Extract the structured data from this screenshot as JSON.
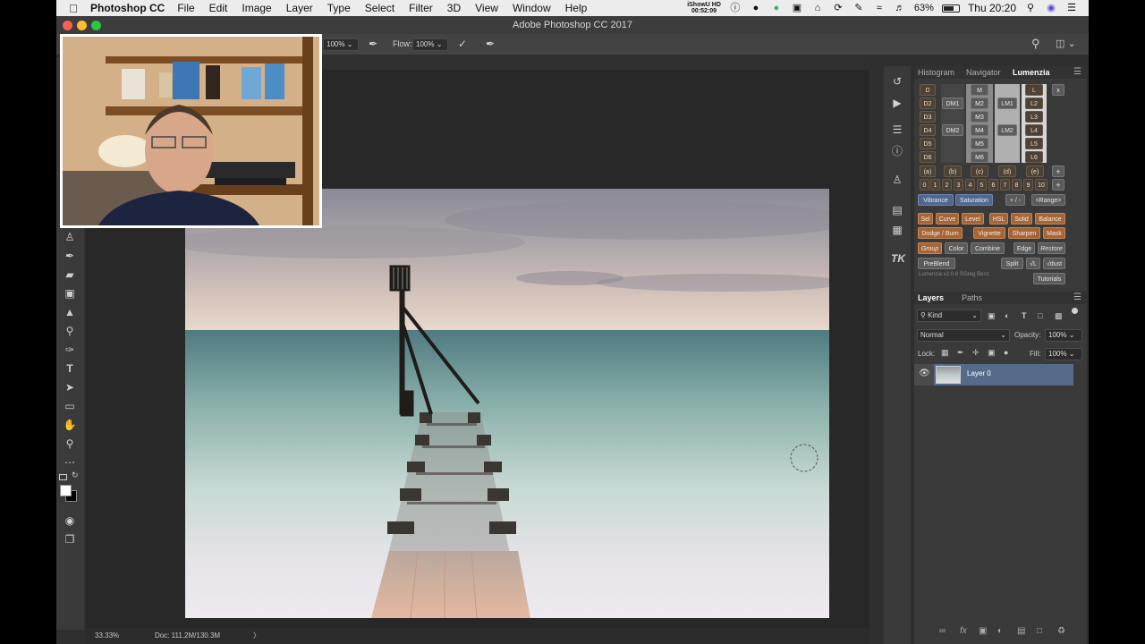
{
  "menubar": {
    "app_name": "Photoshop CC",
    "items": [
      "File",
      "Edit",
      "Image",
      "Layer",
      "Type",
      "Select",
      "Filter",
      "3D",
      "View",
      "Window",
      "Help"
    ],
    "ishowu_line1": "iShowU HD",
    "ishowu_line2": "00:52:09",
    "battery": "63%",
    "clock": "Thu 20:20"
  },
  "window": {
    "title": "Adobe Photoshop CC 2017"
  },
  "options": {
    "opacity_value": "100%",
    "flow_label": "Flow:",
    "flow_value": "100%"
  },
  "status": {
    "zoom": "33.33%",
    "doc": "Doc: 111.2M/130.3M",
    "arrow": "〉"
  },
  "panels": {
    "top_tabs": [
      "Histogram",
      "Navigator",
      "Lumenzia"
    ],
    "lumenzia": {
      "col_d": [
        "D",
        "D2",
        "D3",
        "D4",
        "D5",
        "D6"
      ],
      "col_dm": [
        "DM1",
        "DM2"
      ],
      "col_m": [
        "M",
        "M2",
        "M3",
        "M4",
        "M5",
        "M6"
      ],
      "col_lm": [
        "LM1",
        "LM2"
      ],
      "col_l": [
        "L",
        "L2",
        "L3",
        "L4",
        "L5",
        "L6"
      ],
      "close": "x",
      "paren_row": [
        "(a)",
        "(b)",
        "(c)",
        "(d)",
        "(e)"
      ],
      "plus": "+",
      "number_row": [
        "0",
        "1",
        "2",
        "3",
        "4",
        "5",
        "6",
        "7",
        "8",
        "9",
        "10"
      ],
      "vibrance": "Vibrance",
      "saturation": "Saturation",
      "plusminus": "+ / -",
      "range": "<Range>",
      "row_a": [
        "Sel",
        "Curve",
        "Level",
        "HSL",
        "Solid",
        "Balance"
      ],
      "row_b": [
        "Dodge / Burn",
        "Vignette",
        "Sharpen",
        "Mask"
      ],
      "row_c": [
        "Group",
        "Color",
        "Combine",
        "Edge",
        "Restore"
      ],
      "row_d": [
        "PreBlend",
        "Split",
        "√L",
        "√dust"
      ],
      "version": "Lumenzia v2.0.8 ©Greg Benz",
      "tutorials": "Tutorials"
    },
    "layers_tabs": [
      "Layers",
      "Paths"
    ],
    "kind": "Kind",
    "blend_mode": "Normal",
    "opacity_label": "Opacity:",
    "opacity_value": "100%",
    "lock_label": "Lock:",
    "fill_label": "Fill:",
    "fill_value": "100%",
    "layer_name": "Layer 0"
  }
}
